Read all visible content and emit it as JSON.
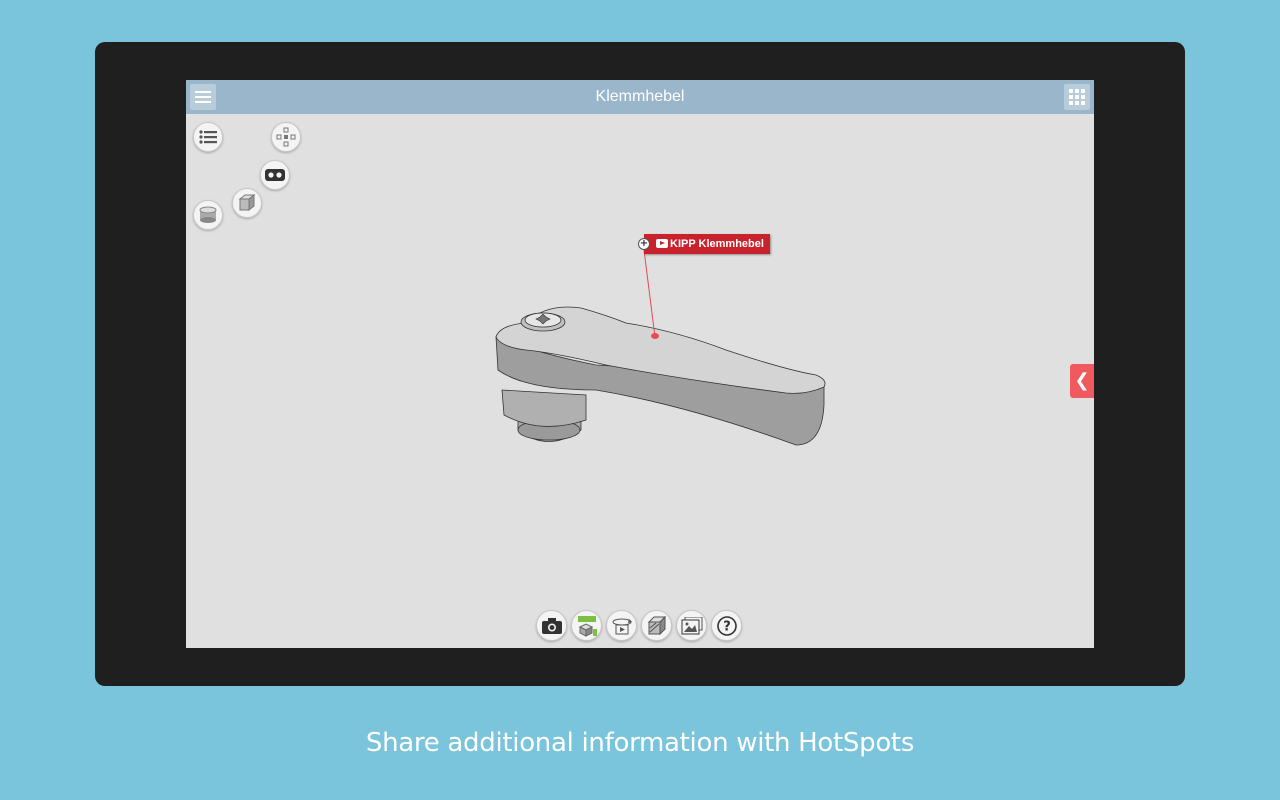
{
  "window": {
    "title": "Klemmhebel"
  },
  "topbar": {
    "menu_icon": "hamburger-icon",
    "apps_icon": "grid-icon"
  },
  "left_controls": [
    {
      "name": "parts-list-button",
      "icon": "list-icon"
    },
    {
      "name": "explode-view-button",
      "icon": "explode-icon"
    },
    {
      "name": "vr-view-button",
      "icon": "vr-goggles-icon"
    },
    {
      "name": "render-mode-button",
      "icon": "cube-icon"
    },
    {
      "name": "cylinder-view-button",
      "icon": "cylinder-icon"
    }
  ],
  "hotspot": {
    "label": "KIPP Klemmhebel",
    "plus": "+",
    "icon": "youtube-icon"
  },
  "side_panel": {
    "arrow": "❮"
  },
  "bottom_toolbar": [
    {
      "name": "screenshot-button",
      "icon": "camera-icon"
    },
    {
      "name": "ar-button",
      "icon": "ar-cube-icon"
    },
    {
      "name": "rotate-animation-button",
      "icon": "rotate-icon"
    },
    {
      "name": "section-button",
      "icon": "section-cube-icon"
    },
    {
      "name": "background-button",
      "icon": "image-icon"
    },
    {
      "name": "help-button",
      "icon": "help-icon"
    }
  ],
  "help_glyph": "?",
  "caption": "Share additional information with HotSpots",
  "colors": {
    "background": "#7ac4dc",
    "tablet": "#1f1f1f",
    "topbar": "#99b6ca",
    "hotspot": "#c8232c",
    "side_tab": "#f05a5f"
  }
}
